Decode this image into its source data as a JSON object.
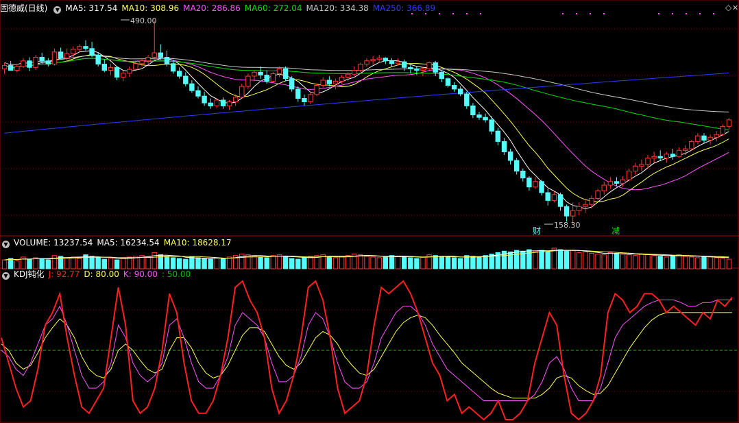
{
  "main_header": {
    "stock_title": "固德威(日线)",
    "ma5": "MA5: 317.54",
    "ma10": "MA10: 308.96",
    "ma20": "MA20: 286.86",
    "ma60": "MA60: 272.04",
    "ma120": "MA120: 334.38",
    "ma250": "MA250: 366.89"
  },
  "volume_header": {
    "title": "VOLUME: 13237.54",
    "ma5": "MA5: 16234.54",
    "ma10": "MA10: 18628.17"
  },
  "kdj_header": {
    "title": "KDJ钝化",
    "j": "J: 92.77",
    "d": "D: 80.00",
    "k": "K: 90.00",
    "level": ": 50.00"
  },
  "annotations": {
    "high": "490.00",
    "low": "158.30",
    "marker_cai": "财",
    "marker_jian": "减"
  },
  "colors": {
    "up": "#ff3a3a",
    "down": "#54fcfc",
    "ma5": "#ffffff",
    "ma10": "#ffff54",
    "ma20": "#ff54ff",
    "ma60": "#00e000",
    "ma120": "#c8c8c8",
    "ma250": "#2a3cff",
    "k": "#ff54ff",
    "d": "#ffff54",
    "j": "#ff2020",
    "level": "#00c000",
    "grid": "#8b0000"
  },
  "chart_data": [
    {
      "type": "candlestick",
      "name": "固德威(日线)",
      "ylim": [
        150,
        510
      ],
      "y_scale": "log",
      "candles": [
        [
          375,
          388,
          365,
          382
        ],
        [
          382,
          392,
          376,
          372
        ],
        [
          372,
          385,
          368,
          380
        ],
        [
          380,
          398,
          377,
          392
        ],
        [
          392,
          400,
          370,
          378
        ],
        [
          378,
          405,
          373,
          400
        ],
        [
          400,
          410,
          385,
          392
        ],
        [
          392,
          398,
          380,
          385
        ],
        [
          385,
          420,
          382,
          412
        ],
        [
          412,
          422,
          395,
          398
        ],
        [
          398,
          420,
          390,
          408
        ],
        [
          408,
          425,
          400,
          418
        ],
        [
          418,
          430,
          412,
          425
        ],
        [
          425,
          440,
          415,
          420
        ],
        [
          420,
          436,
          400,
          405
        ],
        [
          405,
          412,
          380,
          385
        ],
        [
          385,
          395,
          368,
          372
        ],
        [
          372,
          385,
          362,
          378
        ],
        [
          378,
          380,
          352,
          358
        ],
        [
          358,
          372,
          350,
          366
        ],
        [
          366,
          380,
          358,
          374
        ],
        [
          374,
          390,
          370,
          386
        ],
        [
          386,
          398,
          380,
          392
        ],
        [
          392,
          405,
          386,
          400
        ],
        [
          400,
          490,
          395,
          410
        ],
        [
          410,
          430,
          395,
          400
        ],
        [
          400,
          415,
          380,
          386
        ],
        [
          386,
          395,
          365,
          370
        ],
        [
          370,
          378,
          355,
          360
        ],
        [
          360,
          368,
          340,
          345
        ],
        [
          345,
          352,
          328,
          332
        ],
        [
          332,
          340,
          318,
          322
        ],
        [
          322,
          330,
          305,
          310
        ],
        [
          310,
          318,
          300,
          305
        ],
        [
          305,
          318,
          302,
          315
        ],
        [
          315,
          320,
          300,
          305
        ],
        [
          305,
          315,
          298,
          312
        ],
        [
          312,
          325,
          305,
          320
        ],
        [
          320,
          345,
          318,
          340
        ],
        [
          340,
          365,
          335,
          360
        ],
        [
          360,
          372,
          350,
          368
        ],
        [
          368,
          380,
          355,
          362
        ],
        [
          362,
          372,
          345,
          350
        ],
        [
          350,
          368,
          346,
          365
        ],
        [
          365,
          380,
          358,
          375
        ],
        [
          375,
          380,
          350,
          355
        ],
        [
          355,
          360,
          330,
          335
        ],
        [
          335,
          340,
          312,
          318
        ],
        [
          318,
          325,
          305,
          312
        ],
        [
          312,
          330,
          308,
          325
        ],
        [
          325,
          345,
          322,
          342
        ],
        [
          342,
          358,
          338,
          352
        ],
        [
          352,
          360,
          340,
          345
        ],
        [
          345,
          355,
          335,
          350
        ],
        [
          350,
          362,
          345,
          358
        ],
        [
          358,
          368,
          350,
          364
        ],
        [
          364,
          380,
          360,
          372
        ],
        [
          372,
          388,
          368,
          385
        ],
        [
          385,
          398,
          380,
          392
        ],
        [
          392,
          402,
          384,
          395
        ],
        [
          395,
          405,
          388,
          398
        ],
        [
          398,
          400,
          385,
          392
        ],
        [
          392,
          398,
          380,
          386
        ],
        [
          386,
          398,
          382,
          390
        ],
        [
          390,
          395,
          370,
          378
        ],
        [
          378,
          385,
          365,
          375
        ],
        [
          375,
          380,
          362,
          372
        ],
        [
          372,
          378,
          360,
          375
        ],
        [
          375,
          390,
          370,
          388
        ],
        [
          388,
          392,
          360,
          368
        ],
        [
          368,
          372,
          348,
          355
        ],
        [
          355,
          358,
          338,
          342
        ],
        [
          342,
          348,
          330,
          335
        ],
        [
          335,
          340,
          322,
          326
        ],
        [
          326,
          330,
          300,
          305
        ],
        [
          305,
          310,
          285,
          290
        ],
        [
          290,
          295,
          282,
          286
        ],
        [
          286,
          292,
          278,
          282
        ],
        [
          282,
          288,
          260,
          265
        ],
        [
          265,
          270,
          245,
          250
        ],
        [
          250,
          255,
          232,
          236
        ],
        [
          236,
          240,
          220,
          225
        ],
        [
          225,
          228,
          208,
          212
        ],
        [
          212,
          215,
          200,
          204
        ],
        [
          204,
          206,
          190,
          194
        ],
        [
          194,
          205,
          192,
          200
        ],
        [
          200,
          202,
          185,
          188
        ],
        [
          188,
          192,
          175,
          180
        ],
        [
          180,
          190,
          178,
          186
        ],
        [
          186,
          188,
          170,
          174
        ],
        [
          174,
          176,
          160,
          165
        ],
        [
          165,
          178,
          158,
          170
        ],
        [
          170,
          178,
          166,
          174
        ],
        [
          174,
          180,
          168,
          176
        ],
        [
          176,
          185,
          172,
          182
        ],
        [
          182,
          192,
          180,
          190
        ],
        [
          190,
          200,
          186,
          196
        ],
        [
          196,
          205,
          192,
          200
        ],
        [
          200,
          205,
          195,
          198
        ],
        [
          198,
          206,
          194,
          202
        ],
        [
          202,
          215,
          200,
          212
        ],
        [
          212,
          222,
          208,
          218
        ],
        [
          218,
          226,
          212,
          220
        ],
        [
          220,
          232,
          215,
          228
        ],
        [
          228,
          236,
          222,
          230
        ],
        [
          230,
          238,
          224,
          228
        ],
        [
          228,
          236,
          222,
          233
        ],
        [
          233,
          240,
          226,
          230
        ],
        [
          230,
          242,
          228,
          238
        ],
        [
          238,
          245,
          232,
          240
        ],
        [
          240,
          252,
          238,
          250
        ],
        [
          250,
          262,
          246,
          258
        ],
        [
          258,
          262,
          248,
          252
        ],
        [
          252,
          260,
          246,
          256
        ],
        [
          256,
          265,
          250,
          260
        ],
        [
          260,
          275,
          258,
          272
        ],
        [
          272,
          285,
          268,
          282
        ]
      ],
      "ma_lines": [
        "MA5",
        "MA10",
        "MA20",
        "MA60",
        "MA120",
        "MA250"
      ]
    },
    {
      "type": "bar",
      "name": "VOLUME",
      "values": [
        12,
        14,
        11,
        16,
        13,
        15,
        14,
        12,
        18,
        17,
        15,
        16,
        14,
        19,
        17,
        15,
        13,
        14,
        12,
        15,
        16,
        17,
        18,
        16,
        22,
        19,
        17,
        15,
        14,
        13,
        16,
        15,
        14,
        13,
        15,
        14,
        16,
        18,
        20,
        19,
        17,
        16,
        15,
        18,
        19,
        16,
        14,
        13,
        15,
        17,
        18,
        19,
        16,
        15,
        17,
        18,
        20,
        19,
        17,
        16,
        15,
        16,
        18,
        17,
        16,
        15,
        14,
        16,
        19,
        18,
        17,
        16,
        15,
        14,
        18,
        17,
        16,
        18,
        20,
        22,
        24,
        23,
        25,
        24,
        26,
        24,
        25,
        23,
        28,
        26,
        24,
        25,
        22,
        23,
        21,
        20,
        19,
        22,
        21,
        20,
        19,
        18,
        20,
        19,
        18,
        17,
        16,
        18,
        19,
        17,
        16,
        15,
        17,
        16,
        15,
        14,
        13
      ],
      "up": [
        true,
        false,
        true,
        true,
        false,
        true,
        false,
        false,
        true,
        false,
        true,
        true,
        true,
        false,
        false,
        false,
        false,
        true,
        false,
        true,
        true,
        true,
        true,
        true,
        true,
        false,
        false,
        false,
        false,
        false,
        false,
        false,
        false,
        false,
        true,
        false,
        true,
        true,
        true,
        true,
        true,
        false,
        false,
        true,
        true,
        false,
        false,
        false,
        false,
        true,
        true,
        true,
        false,
        true,
        true,
        true,
        true,
        true,
        true,
        true,
        true,
        false,
        false,
        true,
        false,
        false,
        false,
        true,
        true,
        false,
        false,
        false,
        false,
        false,
        false,
        false,
        false,
        false,
        false,
        false,
        false,
        false,
        false,
        false,
        false,
        true,
        false,
        false,
        true,
        false,
        false,
        true,
        true,
        true,
        true,
        true,
        true,
        true,
        false,
        true,
        true,
        true,
        true,
        true,
        true,
        false,
        true,
        false,
        true,
        true,
        true,
        true,
        false,
        true,
        true,
        true,
        true
      ]
    },
    {
      "type": "line",
      "name": "KDJ钝化",
      "ylim": [
        -5,
        105
      ],
      "level": 50,
      "series_j": [
        60,
        40,
        20,
        5,
        10,
        35,
        70,
        80,
        95,
        60,
        30,
        5,
        0,
        10,
        20,
        60,
        100,
        70,
        10,
        0,
        5,
        20,
        50,
        95,
        80,
        40,
        10,
        0,
        0,
        10,
        30,
        60,
        100,
        105,
        90,
        80,
        60,
        20,
        0,
        10,
        30,
        60,
        100,
        105,
        90,
        60,
        20,
        0,
        5,
        10,
        30,
        70,
        100,
        95,
        100,
        105,
        95,
        80,
        60,
        40,
        30,
        10,
        15,
        0,
        5,
        0,
        -5,
        0,
        10,
        -5,
        -5,
        0,
        10,
        40,
        60,
        80,
        70,
        30,
        0,
        -5,
        0,
        10,
        30,
        80,
        95,
        90,
        80,
        85,
        95,
        95,
        90,
        80,
        85,
        80,
        75,
        70,
        80,
        75,
        90,
        85,
        92
      ],
      "series_k": [
        50,
        45,
        35,
        30,
        40,
        55,
        70,
        75,
        85,
        70,
        50,
        30,
        20,
        20,
        25,
        40,
        70,
        60,
        40,
        30,
        25,
        30,
        40,
        70,
        75,
        60,
        40,
        25,
        20,
        20,
        30,
        45,
        70,
        80,
        75,
        70,
        60,
        40,
        25,
        25,
        30,
        45,
        70,
        80,
        75,
        60,
        40,
        25,
        20,
        20,
        25,
        40,
        60,
        70,
        80,
        85,
        85,
        80,
        70,
        55,
        45,
        35,
        30,
        25,
        20,
        15,
        10,
        10,
        10,
        10,
        10,
        10,
        10,
        15,
        25,
        40,
        45,
        35,
        20,
        10,
        10,
        10,
        20,
        40,
        60,
        70,
        75,
        80,
        85,
        88,
        90,
        90,
        90,
        88,
        85,
        85,
        88,
        88,
        90,
        90,
        90
      ],
      "series_d": [
        55,
        50,
        40,
        35,
        38,
        48,
        60,
        68,
        75,
        70,
        60,
        45,
        35,
        30,
        28,
        35,
        50,
        55,
        50,
        42,
        35,
        32,
        35,
        50,
        60,
        60,
        52,
        40,
        32,
        28,
        30,
        38,
        50,
        62,
        68,
        68,
        65,
        55,
        45,
        38,
        35,
        40,
        50,
        60,
        65,
        62,
        55,
        45,
        38,
        32,
        30,
        35,
        45,
        55,
        65,
        72,
        76,
        78,
        76,
        70,
        62,
        55,
        48,
        40,
        35,
        30,
        25,
        20,
        16,
        14,
        12,
        12,
        12,
        12,
        15,
        20,
        28,
        30,
        28,
        22,
        18,
        15,
        16,
        22,
        32,
        42,
        52,
        60,
        68,
        74,
        78,
        80,
        80,
        80,
        80,
        80,
        80,
        80,
        80,
        80,
        80
      ]
    }
  ]
}
